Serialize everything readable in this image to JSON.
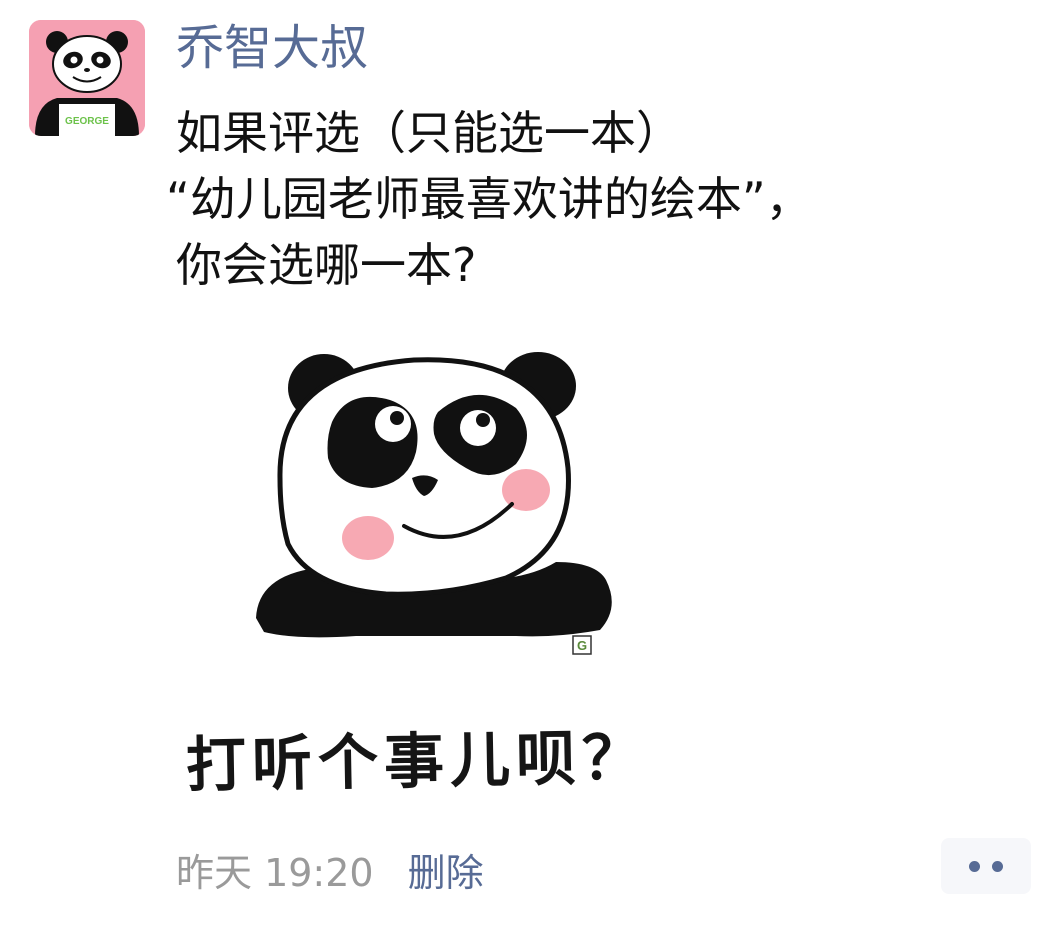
{
  "post": {
    "author": "乔智大叔",
    "text_lines": [
      "如果评选（只能选一本）",
      "“幼儿园老师最喜欢讲的绘本”，",
      "你会选哪一本?"
    ],
    "image": {
      "caption": "打听个事儿呗？",
      "watermark": "G"
    },
    "avatar_text": "GEORGE",
    "timestamp": "昨天 19:20",
    "delete_label": "删除",
    "more_icon": "ellipsis-icon"
  },
  "colors": {
    "link": "#576b95",
    "text": "#111111",
    "meta": "#9a9a9a",
    "avatar_bg": "#f5a0b2",
    "blush": "#f7a9b3"
  }
}
